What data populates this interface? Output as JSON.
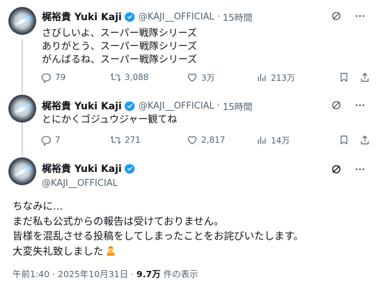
{
  "colors": {
    "accent": "#1d9bf0",
    "secondary_text": "#536471",
    "primary_text": "#0f1419",
    "thread_line": "#cfd9de"
  },
  "tweets": [
    {
      "name": "梶裕貴 Yuki Kaji",
      "handle": "@KAJI__OFFICIAL",
      "time": "15時間",
      "lines": [
        "さびしいよ、スーパー戦隊シリーズ",
        "ありがとう、スーパー戦隊シリーズ",
        "がんばるね、スーパー戦隊シリーズ"
      ],
      "replies": "79",
      "reposts": "3,088",
      "likes": "3万",
      "views": "213万"
    },
    {
      "name": "梶裕貴 Yuki Kaji",
      "handle": "@KAJI__OFFICIAL",
      "time": "15時間",
      "lines": [
        "とにかくゴジュウジャー観てね"
      ],
      "replies": "7",
      "reposts": "271",
      "likes": "2,817",
      "views": "14万"
    }
  ],
  "main": {
    "name": "梶裕貴 Yuki Kaji",
    "handle": "@KAJI__OFFICIAL",
    "lines": [
      "ちなみに…",
      "まだ私も公式からの報告は受けておりません。",
      "皆様を混乱させる投稿をしてしまったことをお詫びいたします。",
      "大変失礼致しました"
    ],
    "timestamp": "午前1:40 · 2025年10月31日 · ",
    "views_count": "9.7万",
    "views_label": " 件の表示"
  },
  "icons": [
    "verified-badge-icon",
    "grok-icon",
    "more-icon",
    "reply-icon",
    "repost-icon",
    "like-icon",
    "views-icon",
    "bookmark-icon",
    "share-icon",
    "bowing-person-emoji"
  ]
}
